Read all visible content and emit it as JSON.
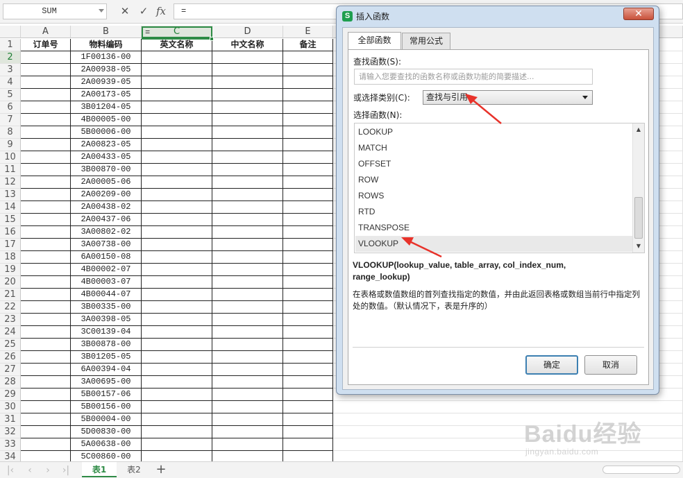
{
  "formula_bar": {
    "name_box": "SUM",
    "cancel_icon": "✕",
    "confirm_icon": "✓",
    "fx_icon": "fx",
    "formula": "="
  },
  "sheet": {
    "columns": [
      "A",
      "B",
      "C",
      "D",
      "E"
    ],
    "headers": [
      "订单号",
      "物料编码",
      "英文名称",
      "中文名称",
      "备注"
    ],
    "active_cell": "C2",
    "active_value": "=",
    "rows": [
      {
        "num": "1"
      },
      {
        "num": "2",
        "code": "1F00136-00"
      },
      {
        "num": "3",
        "code": "2A00938-05"
      },
      {
        "num": "4",
        "code": "2A00939-05"
      },
      {
        "num": "5",
        "code": "2A00173-05"
      },
      {
        "num": "6",
        "code": "3B01204-05"
      },
      {
        "num": "7",
        "code": "4B00005-00"
      },
      {
        "num": "8",
        "code": "5B00006-00"
      },
      {
        "num": "9",
        "code": "2A00823-05"
      },
      {
        "num": "10",
        "code": "2A00433-05"
      },
      {
        "num": "11",
        "code": "3B00870-00"
      },
      {
        "num": "12",
        "code": "2A00005-06"
      },
      {
        "num": "13",
        "code": "2A00209-00"
      },
      {
        "num": "14",
        "code": "2A00438-02"
      },
      {
        "num": "15",
        "code": "2A00437-06"
      },
      {
        "num": "16",
        "code": "3A00802-02"
      },
      {
        "num": "17",
        "code": "3A00738-00"
      },
      {
        "num": "18",
        "code": "6A00150-08"
      },
      {
        "num": "19",
        "code": "4B00002-07"
      },
      {
        "num": "20",
        "code": "4B00003-07"
      },
      {
        "num": "21",
        "code": "4B00044-07"
      },
      {
        "num": "22",
        "code": "3B00335-00"
      },
      {
        "num": "23",
        "code": "3A00398-05"
      },
      {
        "num": "24",
        "code": "3C00139-04"
      },
      {
        "num": "25",
        "code": "3B00878-00"
      },
      {
        "num": "26",
        "code": "3B01205-05"
      },
      {
        "num": "27",
        "code": "6A00394-04"
      },
      {
        "num": "28",
        "code": "3A00695-00"
      },
      {
        "num": "29",
        "code": "5B00157-06"
      },
      {
        "num": "30",
        "code": "5B00156-00"
      },
      {
        "num": "31",
        "code": "5B00004-00"
      },
      {
        "num": "32",
        "code": "5D00830-00"
      },
      {
        "num": "33",
        "code": "5A00638-00"
      },
      {
        "num": "34",
        "code": "5C00860-00"
      }
    ],
    "tabs": [
      "表1",
      "表2"
    ],
    "add_tab": "+"
  },
  "watermark": {
    "logo": "Baidu经验",
    "url": "jingyan.baidu.com"
  },
  "dialog": {
    "logo": "S",
    "title": "插入函数",
    "close": "✕",
    "tabs": [
      "全部函数",
      "常用公式"
    ],
    "search_label": "查找函数(S):",
    "search_placeholder": "请输入您要查找的函数名称或函数功能的简要描述...",
    "category_label": "或选择类别(C):",
    "category_value": "查找与引用",
    "function_label": "选择函数(N):",
    "functions": [
      "LOOKUP",
      "MATCH",
      "OFFSET",
      "ROW",
      "ROWS",
      "RTD",
      "TRANSPOSE",
      "VLOOKUP"
    ],
    "selected_function": "VLOOKUP",
    "signature_line1": "VLOOKUP(lookup_value, table_array, col_index_num,",
    "signature_line2": "range_lookup)",
    "description": "在表格或数值数组的首列查找指定的数值，并由此返回表格或数组当前行中指定列处的数值。（默认情况下，表是升序的）",
    "ok": "确定",
    "cancel": "取消"
  },
  "colors": {
    "accent_green": "#2e8b45",
    "arrow_red": "#e8322a",
    "dialog_frame": "#cfdff0"
  }
}
